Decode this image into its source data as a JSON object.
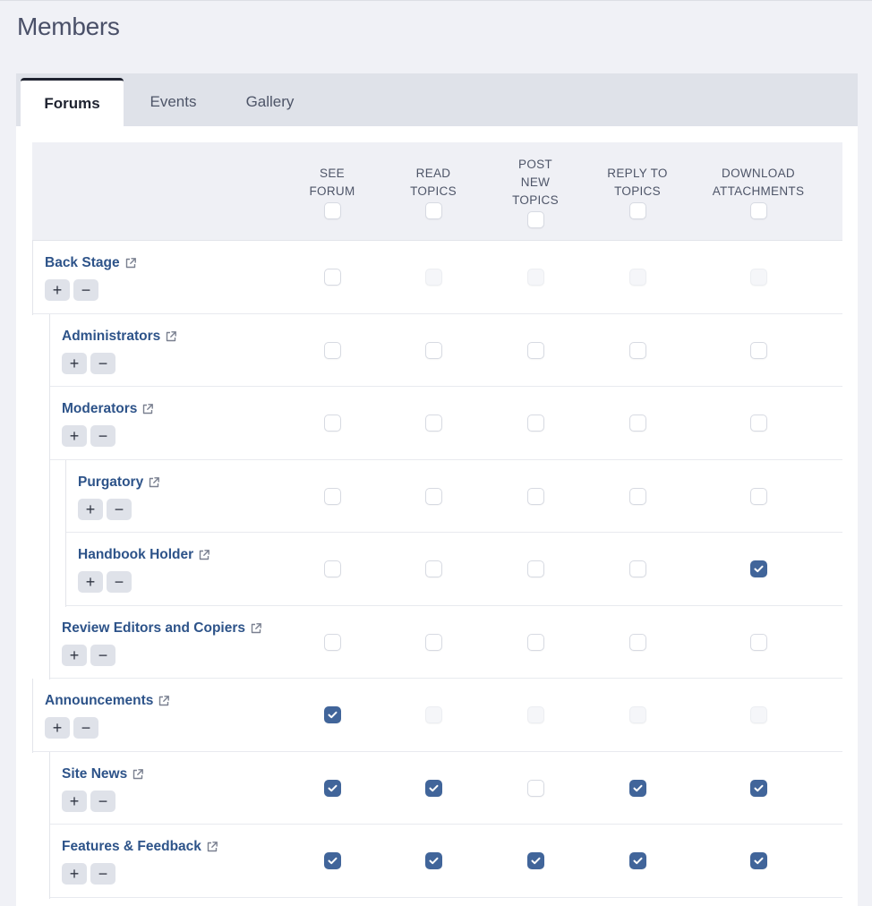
{
  "page": {
    "title": "Members"
  },
  "tabs": [
    {
      "label": "Forums",
      "active": true
    },
    {
      "label": "Events",
      "active": false
    },
    {
      "label": "Gallery",
      "active": false
    }
  ],
  "columns": [
    {
      "label": "SEE\nFORUM"
    },
    {
      "label": "READ\nTOPICS"
    },
    {
      "label": "POST\nNEW\nTOPICS"
    },
    {
      "label": "REPLY TO\nTOPICS"
    },
    {
      "label": "DOWNLOAD\nATTACHMENTS"
    }
  ],
  "header_checkboxes": [
    "unchecked",
    "unchecked",
    "unchecked",
    "unchecked",
    "unchecked"
  ],
  "icons": {
    "external_link": "external-link-icon",
    "expand": "+",
    "collapse": "−",
    "check": "check-icon"
  },
  "colors": {
    "link": "#2d5389",
    "checked": "#41659a",
    "title": "#4a5068"
  },
  "rows": [
    {
      "name": "Back Stage",
      "level": 0,
      "perms": [
        "unchecked",
        "disabled",
        "disabled",
        "disabled",
        "disabled"
      ]
    },
    {
      "name": "Administrators",
      "level": 1,
      "perms": [
        "unchecked",
        "unchecked",
        "unchecked",
        "unchecked",
        "unchecked"
      ]
    },
    {
      "name": "Moderators",
      "level": 1,
      "perms": [
        "unchecked",
        "unchecked",
        "unchecked",
        "unchecked",
        "unchecked"
      ]
    },
    {
      "name": "Purgatory",
      "level": 2,
      "perms": [
        "unchecked",
        "unchecked",
        "unchecked",
        "unchecked",
        "unchecked"
      ]
    },
    {
      "name": "Handbook Holder",
      "level": 2,
      "perms": [
        "unchecked",
        "unchecked",
        "unchecked",
        "unchecked",
        "checked"
      ]
    },
    {
      "name": "Review Editors and Copiers",
      "level": 1,
      "perms": [
        "unchecked",
        "unchecked",
        "unchecked",
        "unchecked",
        "unchecked"
      ]
    },
    {
      "name": "Announcements",
      "level": 0,
      "perms": [
        "checked",
        "disabled",
        "disabled",
        "disabled",
        "disabled"
      ]
    },
    {
      "name": "Site News",
      "level": 1,
      "perms": [
        "checked",
        "checked",
        "unchecked",
        "checked",
        "checked"
      ]
    },
    {
      "name": "Features & Feedback",
      "level": 1,
      "perms": [
        "checked",
        "checked",
        "checked",
        "checked",
        "checked"
      ]
    }
  ]
}
